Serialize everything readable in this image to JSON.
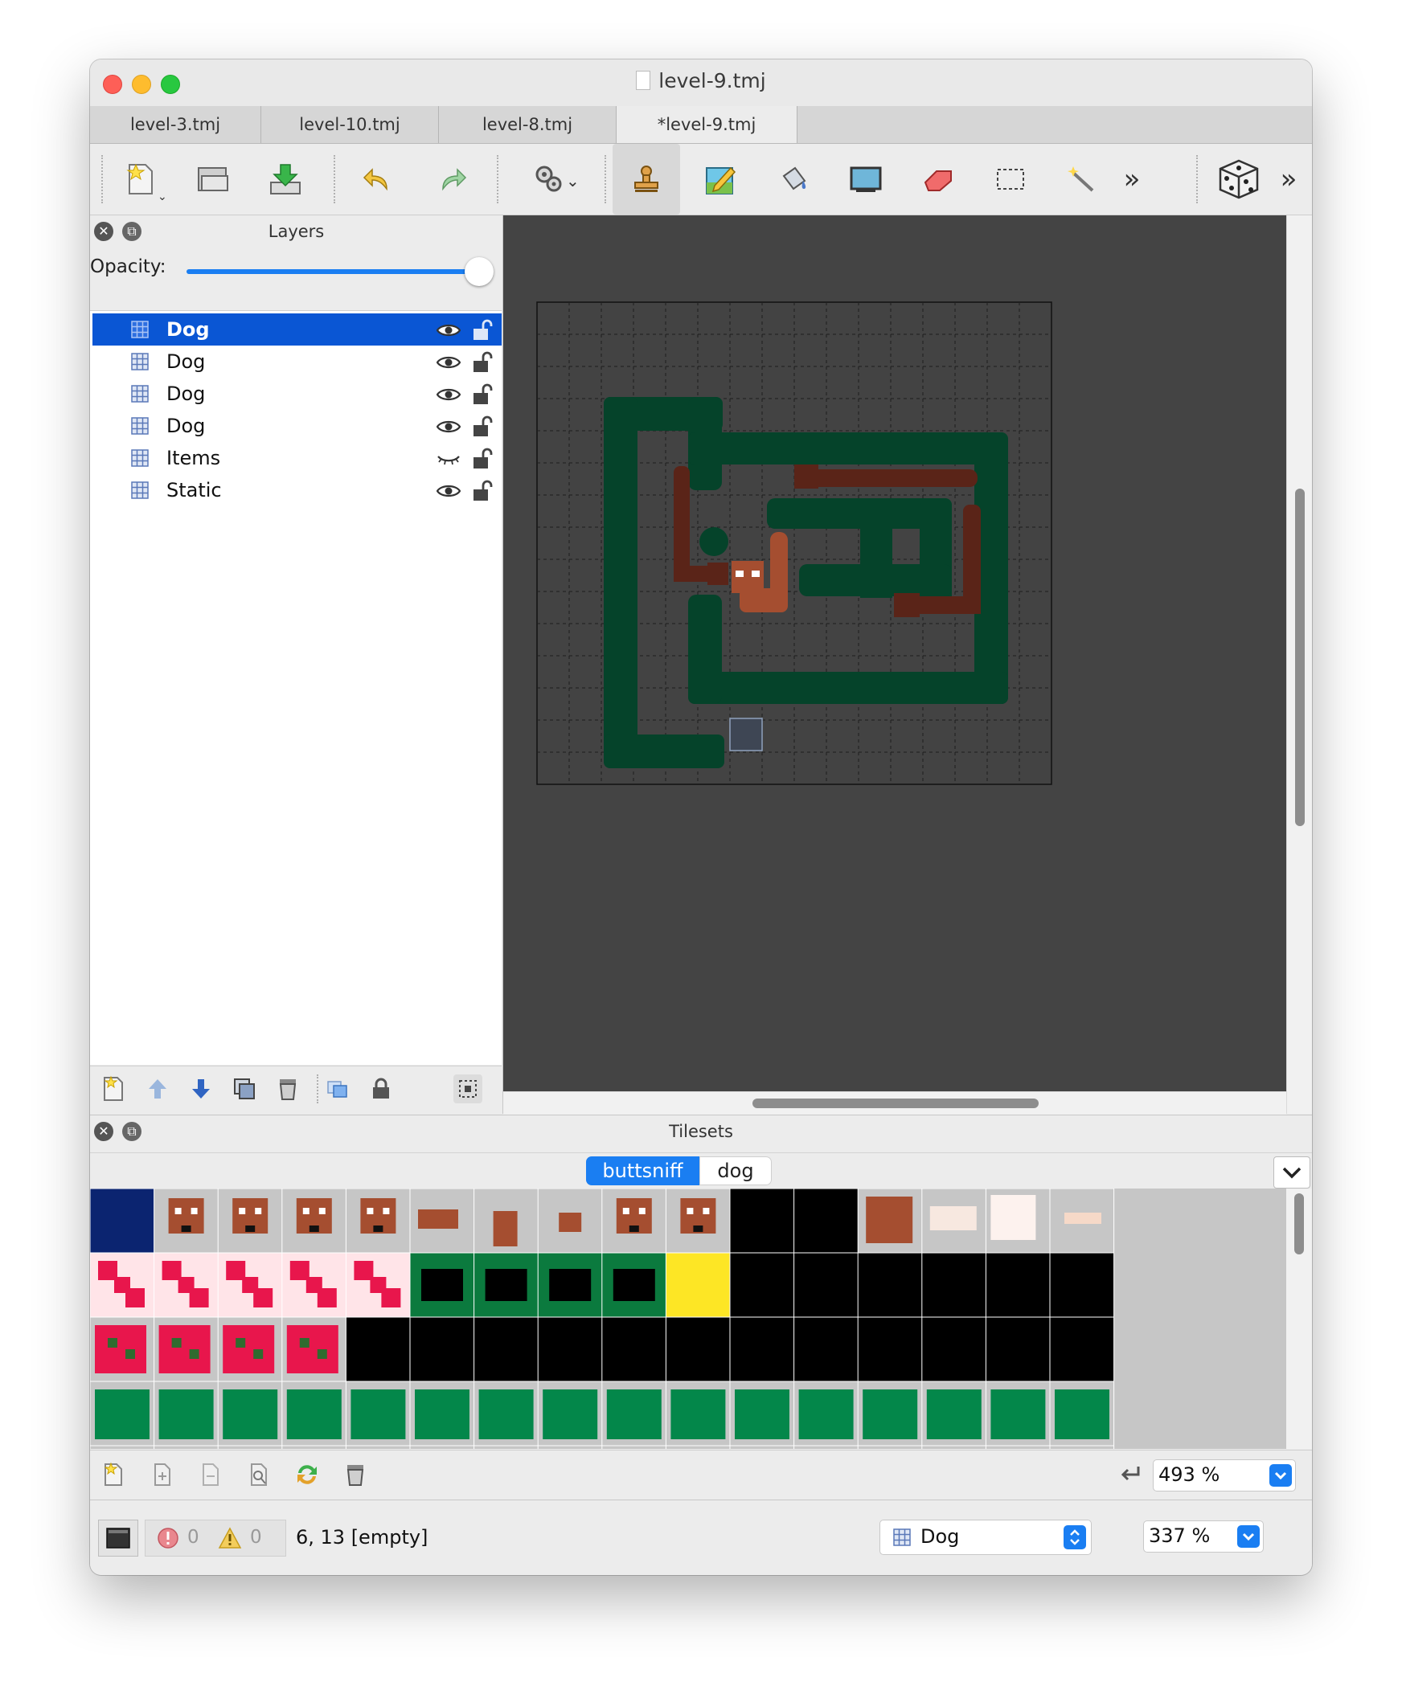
{
  "window": {
    "title": "level-9.tmj"
  },
  "tabs": [
    {
      "label": "level-3.tmj"
    },
    {
      "label": "level-10.tmj"
    },
    {
      "label": "level-8.tmj"
    },
    {
      "label": "*level-9.tmj"
    }
  ],
  "toolbar": {
    "buttons": [
      "new-map",
      "open",
      "save",
      "undo",
      "redo",
      "commands",
      "stamp-brush",
      "terrain-brush",
      "bucket-fill",
      "shape-fill",
      "eraser",
      "rect-select",
      "magic-wand",
      "more",
      "random-mode",
      "more-2"
    ],
    "more_glyph": "»"
  },
  "layers_panel": {
    "title": "Layers",
    "opacity_label": "Opacity:",
    "opacity": 1.0,
    "items": [
      {
        "name": "Dog",
        "visible": true,
        "selected": true
      },
      {
        "name": "Dog",
        "visible": true,
        "selected": false
      },
      {
        "name": "Dog",
        "visible": true,
        "selected": false
      },
      {
        "name": "Dog",
        "visible": true,
        "selected": false
      },
      {
        "name": "Items",
        "visible": false,
        "selected": false
      },
      {
        "name": "Static",
        "visible": true,
        "selected": false
      }
    ]
  },
  "tilesets_panel": {
    "title": "Tilesets",
    "tabs": [
      {
        "label": "buttsniff"
      },
      {
        "label": "dog"
      }
    ],
    "zoom": "493 %"
  },
  "status_bar": {
    "errors": "0",
    "warnings": "0",
    "cursor_info": "6, 13 [empty]",
    "current_layer": "Dog",
    "zoom": "337 %"
  },
  "colors": {
    "accent": "#1a7ef2",
    "selection": "#0a56d4",
    "map_bg": "#444444",
    "wall": "#05432a",
    "dog_dark": "#5a2418",
    "dog_light": "#a54e30"
  }
}
